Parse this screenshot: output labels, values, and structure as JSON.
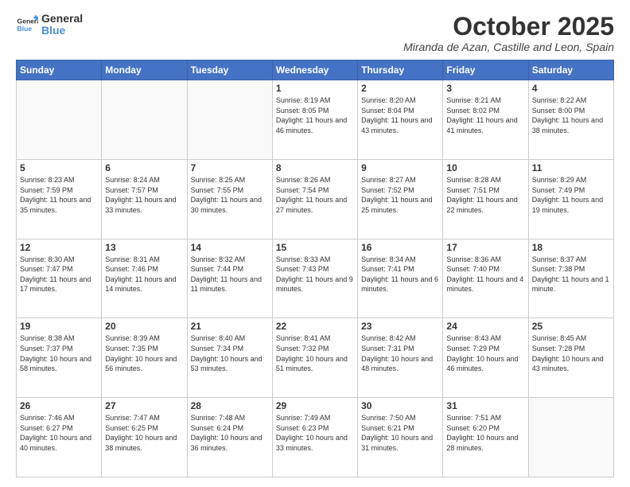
{
  "logo": {
    "text1": "General",
    "text2": "Blue"
  },
  "title": "October 2025",
  "subtitle": "Miranda de Azan, Castille and Leon, Spain",
  "days_of_week": [
    "Sunday",
    "Monday",
    "Tuesday",
    "Wednesday",
    "Thursday",
    "Friday",
    "Saturday"
  ],
  "weeks": [
    [
      {
        "day": "",
        "info": ""
      },
      {
        "day": "",
        "info": ""
      },
      {
        "day": "",
        "info": ""
      },
      {
        "day": "1",
        "info": "Sunrise: 8:19 AM\nSunset: 8:05 PM\nDaylight: 11 hours and 46 minutes."
      },
      {
        "day": "2",
        "info": "Sunrise: 8:20 AM\nSunset: 8:04 PM\nDaylight: 11 hours and 43 minutes."
      },
      {
        "day": "3",
        "info": "Sunrise: 8:21 AM\nSunset: 8:02 PM\nDaylight: 11 hours and 41 minutes."
      },
      {
        "day": "4",
        "info": "Sunrise: 8:22 AM\nSunset: 8:00 PM\nDaylight: 11 hours and 38 minutes."
      }
    ],
    [
      {
        "day": "5",
        "info": "Sunrise: 8:23 AM\nSunset: 7:59 PM\nDaylight: 11 hours and 35 minutes."
      },
      {
        "day": "6",
        "info": "Sunrise: 8:24 AM\nSunset: 7:57 PM\nDaylight: 11 hours and 33 minutes."
      },
      {
        "day": "7",
        "info": "Sunrise: 8:25 AM\nSunset: 7:55 PM\nDaylight: 11 hours and 30 minutes."
      },
      {
        "day": "8",
        "info": "Sunrise: 8:26 AM\nSunset: 7:54 PM\nDaylight: 11 hours and 27 minutes."
      },
      {
        "day": "9",
        "info": "Sunrise: 8:27 AM\nSunset: 7:52 PM\nDaylight: 11 hours and 25 minutes."
      },
      {
        "day": "10",
        "info": "Sunrise: 8:28 AM\nSunset: 7:51 PM\nDaylight: 11 hours and 22 minutes."
      },
      {
        "day": "11",
        "info": "Sunrise: 8:29 AM\nSunset: 7:49 PM\nDaylight: 11 hours and 19 minutes."
      }
    ],
    [
      {
        "day": "12",
        "info": "Sunrise: 8:30 AM\nSunset: 7:47 PM\nDaylight: 11 hours and 17 minutes."
      },
      {
        "day": "13",
        "info": "Sunrise: 8:31 AM\nSunset: 7:46 PM\nDaylight: 11 hours and 14 minutes."
      },
      {
        "day": "14",
        "info": "Sunrise: 8:32 AM\nSunset: 7:44 PM\nDaylight: 11 hours and 11 minutes."
      },
      {
        "day": "15",
        "info": "Sunrise: 8:33 AM\nSunset: 7:43 PM\nDaylight: 11 hours and 9 minutes."
      },
      {
        "day": "16",
        "info": "Sunrise: 8:34 AM\nSunset: 7:41 PM\nDaylight: 11 hours and 6 minutes."
      },
      {
        "day": "17",
        "info": "Sunrise: 8:36 AM\nSunset: 7:40 PM\nDaylight: 11 hours and 4 minutes."
      },
      {
        "day": "18",
        "info": "Sunrise: 8:37 AM\nSunset: 7:38 PM\nDaylight: 11 hours and 1 minute."
      }
    ],
    [
      {
        "day": "19",
        "info": "Sunrise: 8:38 AM\nSunset: 7:37 PM\nDaylight: 10 hours and 58 minutes."
      },
      {
        "day": "20",
        "info": "Sunrise: 8:39 AM\nSunset: 7:35 PM\nDaylight: 10 hours and 56 minutes."
      },
      {
        "day": "21",
        "info": "Sunrise: 8:40 AM\nSunset: 7:34 PM\nDaylight: 10 hours and 53 minutes."
      },
      {
        "day": "22",
        "info": "Sunrise: 8:41 AM\nSunset: 7:32 PM\nDaylight: 10 hours and 51 minutes."
      },
      {
        "day": "23",
        "info": "Sunrise: 8:42 AM\nSunset: 7:31 PM\nDaylight: 10 hours and 48 minutes."
      },
      {
        "day": "24",
        "info": "Sunrise: 8:43 AM\nSunset: 7:29 PM\nDaylight: 10 hours and 46 minutes."
      },
      {
        "day": "25",
        "info": "Sunrise: 8:45 AM\nSunset: 7:28 PM\nDaylight: 10 hours and 43 minutes."
      }
    ],
    [
      {
        "day": "26",
        "info": "Sunrise: 7:46 AM\nSunset: 6:27 PM\nDaylight: 10 hours and 40 minutes."
      },
      {
        "day": "27",
        "info": "Sunrise: 7:47 AM\nSunset: 6:25 PM\nDaylight: 10 hours and 38 minutes."
      },
      {
        "day": "28",
        "info": "Sunrise: 7:48 AM\nSunset: 6:24 PM\nDaylight: 10 hours and 36 minutes."
      },
      {
        "day": "29",
        "info": "Sunrise: 7:49 AM\nSunset: 6:23 PM\nDaylight: 10 hours and 33 minutes."
      },
      {
        "day": "30",
        "info": "Sunrise: 7:50 AM\nSunset: 6:21 PM\nDaylight: 10 hours and 31 minutes."
      },
      {
        "day": "31",
        "info": "Sunrise: 7:51 AM\nSunset: 6:20 PM\nDaylight: 10 hours and 28 minutes."
      },
      {
        "day": "",
        "info": ""
      }
    ]
  ]
}
